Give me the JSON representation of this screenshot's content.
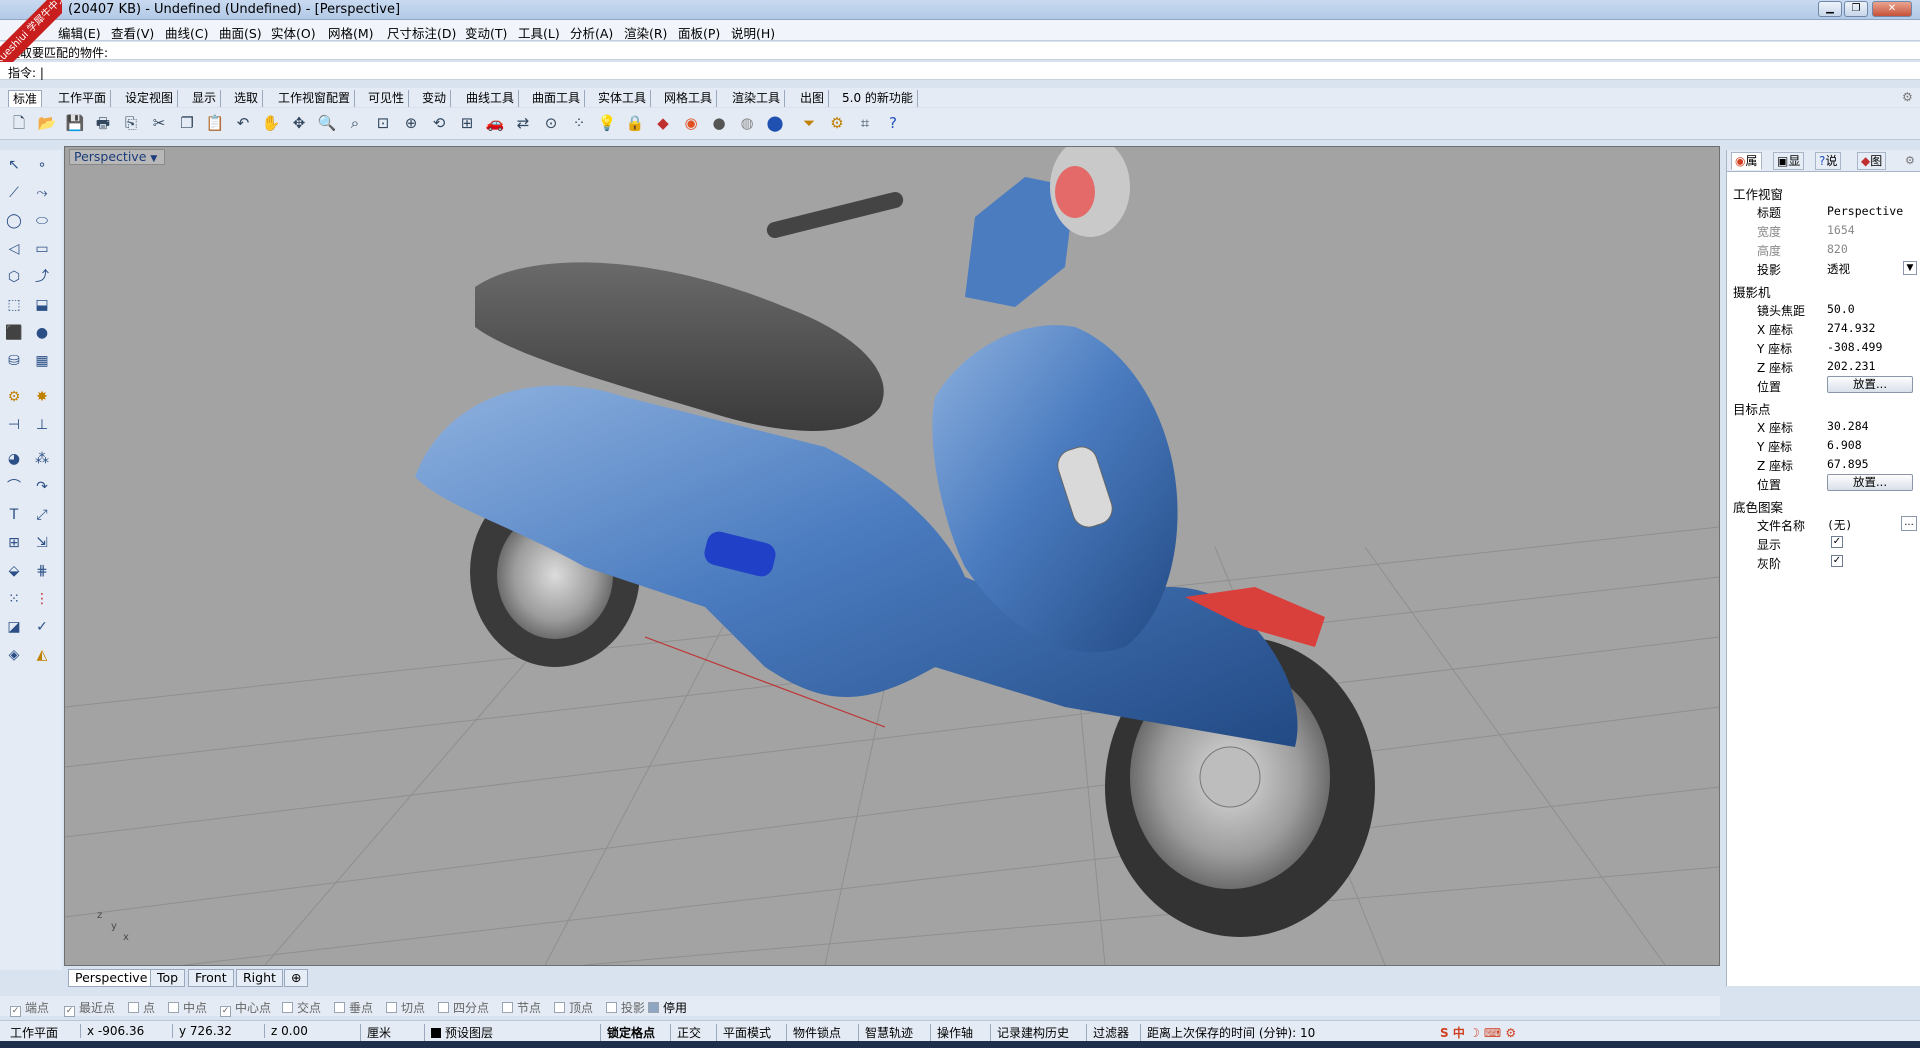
{
  "window": {
    "title": "(20407 KB) - Undefined (Undefined) - [Perspective]",
    "watermark": "xueshiui 学犀牛中文网"
  },
  "menu": [
    "编辑(E)",
    "查看(V)",
    "曲线(C)",
    "曲面(S)",
    "实体(O)",
    "网格(M)",
    "尺寸标注(D)",
    "变动(T)",
    "工具(L)",
    "分析(A)",
    "渲染(R)",
    "面板(P)",
    "说明(H)"
  ],
  "command": {
    "history": "选取要匹配的物件:",
    "prompt": "指令: |"
  },
  "toolbar_tabs": [
    "标准",
    "工作平面",
    "设定视图",
    "显示",
    "选取",
    "工作视窗配置",
    "可见性",
    "变动",
    "曲线工具",
    "曲面工具",
    "实体工具",
    "网格工具",
    "渲染工具",
    "出图",
    "5.0 的新功能"
  ],
  "viewport": {
    "label": "Perspective",
    "tabs": [
      "Perspective",
      "Top",
      "Front",
      "Right"
    ],
    "axis_z": "z",
    "axis_y": "y",
    "axis_x": "x"
  },
  "panel": {
    "tabs": [
      "属",
      "显",
      "说",
      "图"
    ],
    "sections": {
      "viewport": "工作视窗",
      "camera": "摄影机",
      "target": "目标点",
      "wallpaper": "底色图案"
    },
    "title_label": "标题",
    "title_value": "Perspective",
    "width_label": "宽度",
    "width_value": "1654",
    "height_label": "高度",
    "height_value": "820",
    "projection_label": "投影",
    "projection_value": "透视",
    "lens_label": "镜头焦距",
    "lens_value": "50.0",
    "cam_x_label": "X 座标",
    "cam_x": "274.932",
    "cam_y_label": "Y 座标",
    "cam_y": "-308.499",
    "cam_z_label": "Z 座标",
    "cam_z": "202.231",
    "position_label": "位置",
    "place_button": "放置...",
    "tgt_x": "30.284",
    "tgt_y": "6.908",
    "tgt_z": "67.895",
    "filename_label": "文件名称",
    "filename_value": "(无)",
    "show_label": "显示",
    "gray_label": "灰阶",
    "browse": "..."
  },
  "osnap": [
    "端点",
    "最近点",
    "点",
    "中点",
    "中心点",
    "交点",
    "垂点",
    "切点",
    "四分点",
    "节点",
    "顶点",
    "投影",
    "停用"
  ],
  "status": {
    "cplane": "工作平面",
    "x": "x -906.36",
    "y": "y 726.32",
    "z": "z 0.00",
    "unit": "厘米",
    "layer": "预设图层",
    "items": [
      "锁定格点",
      "正交",
      "平面模式",
      "物件锁点",
      "智慧轨迹",
      "操作轴",
      "记录建构历史",
      "过滤器"
    ],
    "autosave": "距离上次保存的时间 (分钟): 10"
  }
}
